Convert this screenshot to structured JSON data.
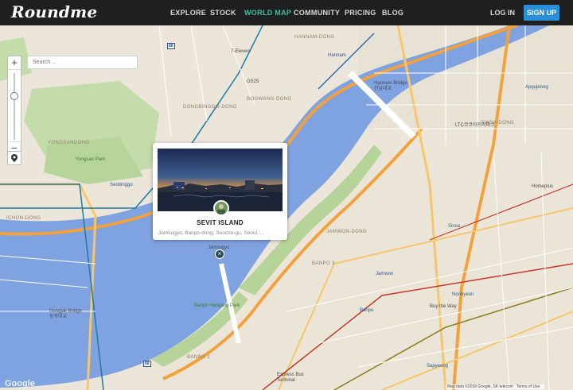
{
  "brand": {
    "logo_text": "Roundme"
  },
  "nav": {
    "items": [
      "EXPLORE",
      "STOCK",
      "WORLD MAP",
      "COMMUNITY",
      "PRICING",
      "BLOG"
    ],
    "active": "WORLD MAP",
    "login": "LOG IN",
    "signup": "SIGN UP"
  },
  "search": {
    "placeholder": "Search ..."
  },
  "zoom": {
    "plus": "+",
    "minus": "−"
  },
  "popup": {
    "title": "SEVIT ISLAND",
    "subtitle": "Jamsugyo, Banpo-dong, Seocho-gu, Seoul, ..."
  },
  "map_labels": {
    "hannam_dong": "HANNAM-DONG",
    "hannam": "Hannam",
    "hannam_bridge": "Hannam Bridge\n한남대교",
    "bogwang_dong": "BOGWANG-DONG",
    "dongbinggo_dong": "DONGBINGGO-DONG",
    "yongsandong": "YONGSANDONG",
    "yongsan_park": "Yongsan Park",
    "seobinggo": "Seobinggo",
    "ichon_dong": "ICHON-DONG",
    "jamwon_dong": "JAMWON-DONG",
    "banpo3": "BANPO 3",
    "banpo2": "BANPO 2",
    "sinsa": "Sinsa",
    "sinsa_dong": "SINSA-DONG",
    "apgujeong": "Apgujeong",
    "jamwon": "Jamwon",
    "banpo": "Banpo",
    "nonhyeon": "Nonhyeon",
    "sapyeong": "Sapyeong",
    "dongjak_bridge": "Dongjak Bridge\n동작대교",
    "banpo_hangang_park": "Banpo Hangang Park",
    "express_bus": "Express Bus\nTerminal",
    "jamsugyo": "Jamsugyo",
    "gs25": "GS25",
    "seven_eleven": "7-Eleven",
    "homeplus": "Homeplus",
    "buy_the_way": "Buy the Way",
    "ltc": "LTC코코아트리파크"
  },
  "footer": {
    "map_data": "Map data ©2018 Google, SK telecom",
    "terms": "Terms of Use"
  },
  "google_watermark": "Google",
  "colors": {
    "accent": "#3fc1a3",
    "signup": "#2a8fd9",
    "river": "#7fa2e0",
    "park": "#bcdca4",
    "highway": "#f3a13c"
  }
}
